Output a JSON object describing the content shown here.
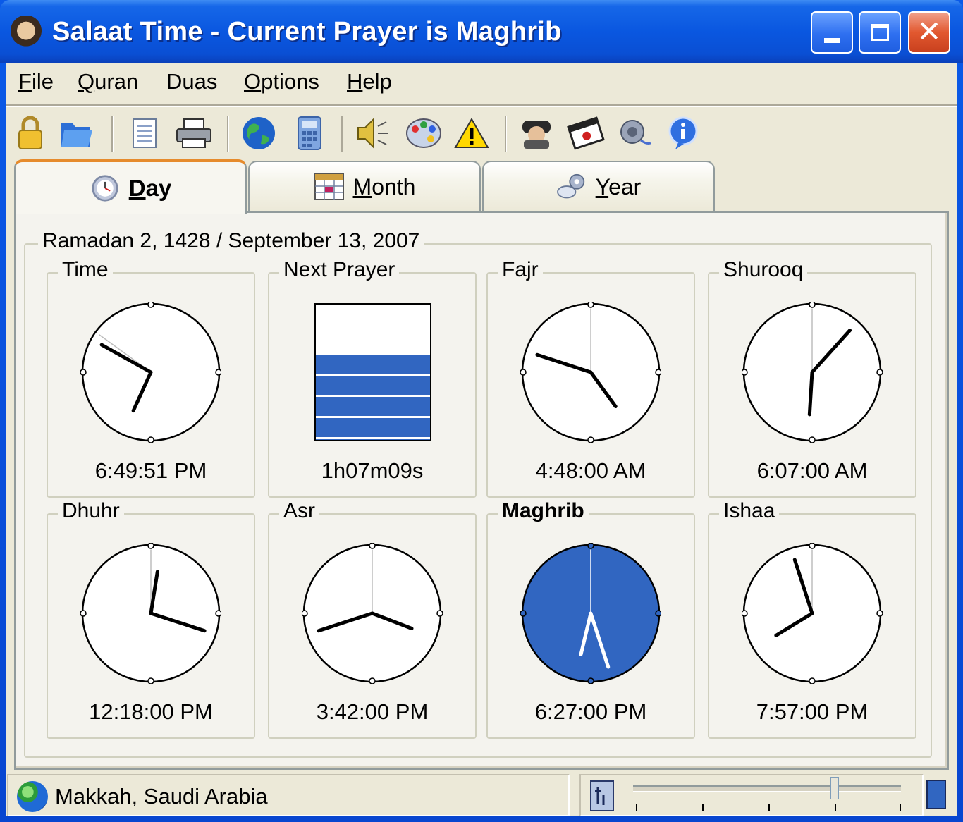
{
  "window": {
    "title": "Salaat Time - Current Prayer is Maghrib"
  },
  "menu": [
    {
      "label": "File",
      "accel": "F",
      "rest": "ile"
    },
    {
      "label": "Quran",
      "accel": "Q",
      "rest": "uran"
    },
    {
      "label": "Duas",
      "accel": "Du",
      "rest": "as"
    },
    {
      "label": "Options",
      "accel": "O",
      "rest": "ptions"
    },
    {
      "label": "Help",
      "accel": "H",
      "rest": "elp"
    }
  ],
  "toolbar": {
    "icons": [
      "lock-icon",
      "open-folder-icon",
      "notepad-icon",
      "printer-icon",
      "globe-icon",
      "calculator-icon",
      "speaker-icon",
      "palette-icon",
      "warning-icon",
      "person-icon",
      "calendar-icon",
      "sound-icon",
      "info-icon"
    ]
  },
  "tabs": [
    {
      "label": "Day",
      "accel": "D",
      "rest": "ay",
      "active": true
    },
    {
      "label": "Month",
      "accel": "M",
      "rest": "onth",
      "active": false
    },
    {
      "label": "Year",
      "accel": "Y",
      "rest": "ear",
      "active": false
    }
  ],
  "day": {
    "date_label": "Ramadan 2, 1428 / September 13, 2007",
    "cells": [
      {
        "label": "Time",
        "value": "6:49:51 PM",
        "bold": false
      },
      {
        "label": "Next Prayer",
        "value": "1h07m09s",
        "bold": false
      },
      {
        "label": "Fajr",
        "value": "4:48:00 AM",
        "bold": false
      },
      {
        "label": "Shurooq",
        "value": "6:07:00 AM",
        "bold": false
      },
      {
        "label": "Dhuhr",
        "value": "12:18:00 PM",
        "bold": false
      },
      {
        "label": "Asr",
        "value": "3:42:00 PM",
        "bold": false
      },
      {
        "label": "Maghrib",
        "value": "6:27:00 PM",
        "bold": true
      },
      {
        "label": "Ishaa",
        "value": "7:57:00 PM",
        "bold": false
      }
    ],
    "next_prayer_progress": 0.63
  },
  "status": {
    "location": "Makkah, Saudi Arabia",
    "slider_value": 0.75
  },
  "colors": {
    "accent_blue": "#3166c1",
    "titlebar_blue": "#0a57e0",
    "close_red": "#e2582f",
    "face_bg": "#f4f3ee"
  }
}
